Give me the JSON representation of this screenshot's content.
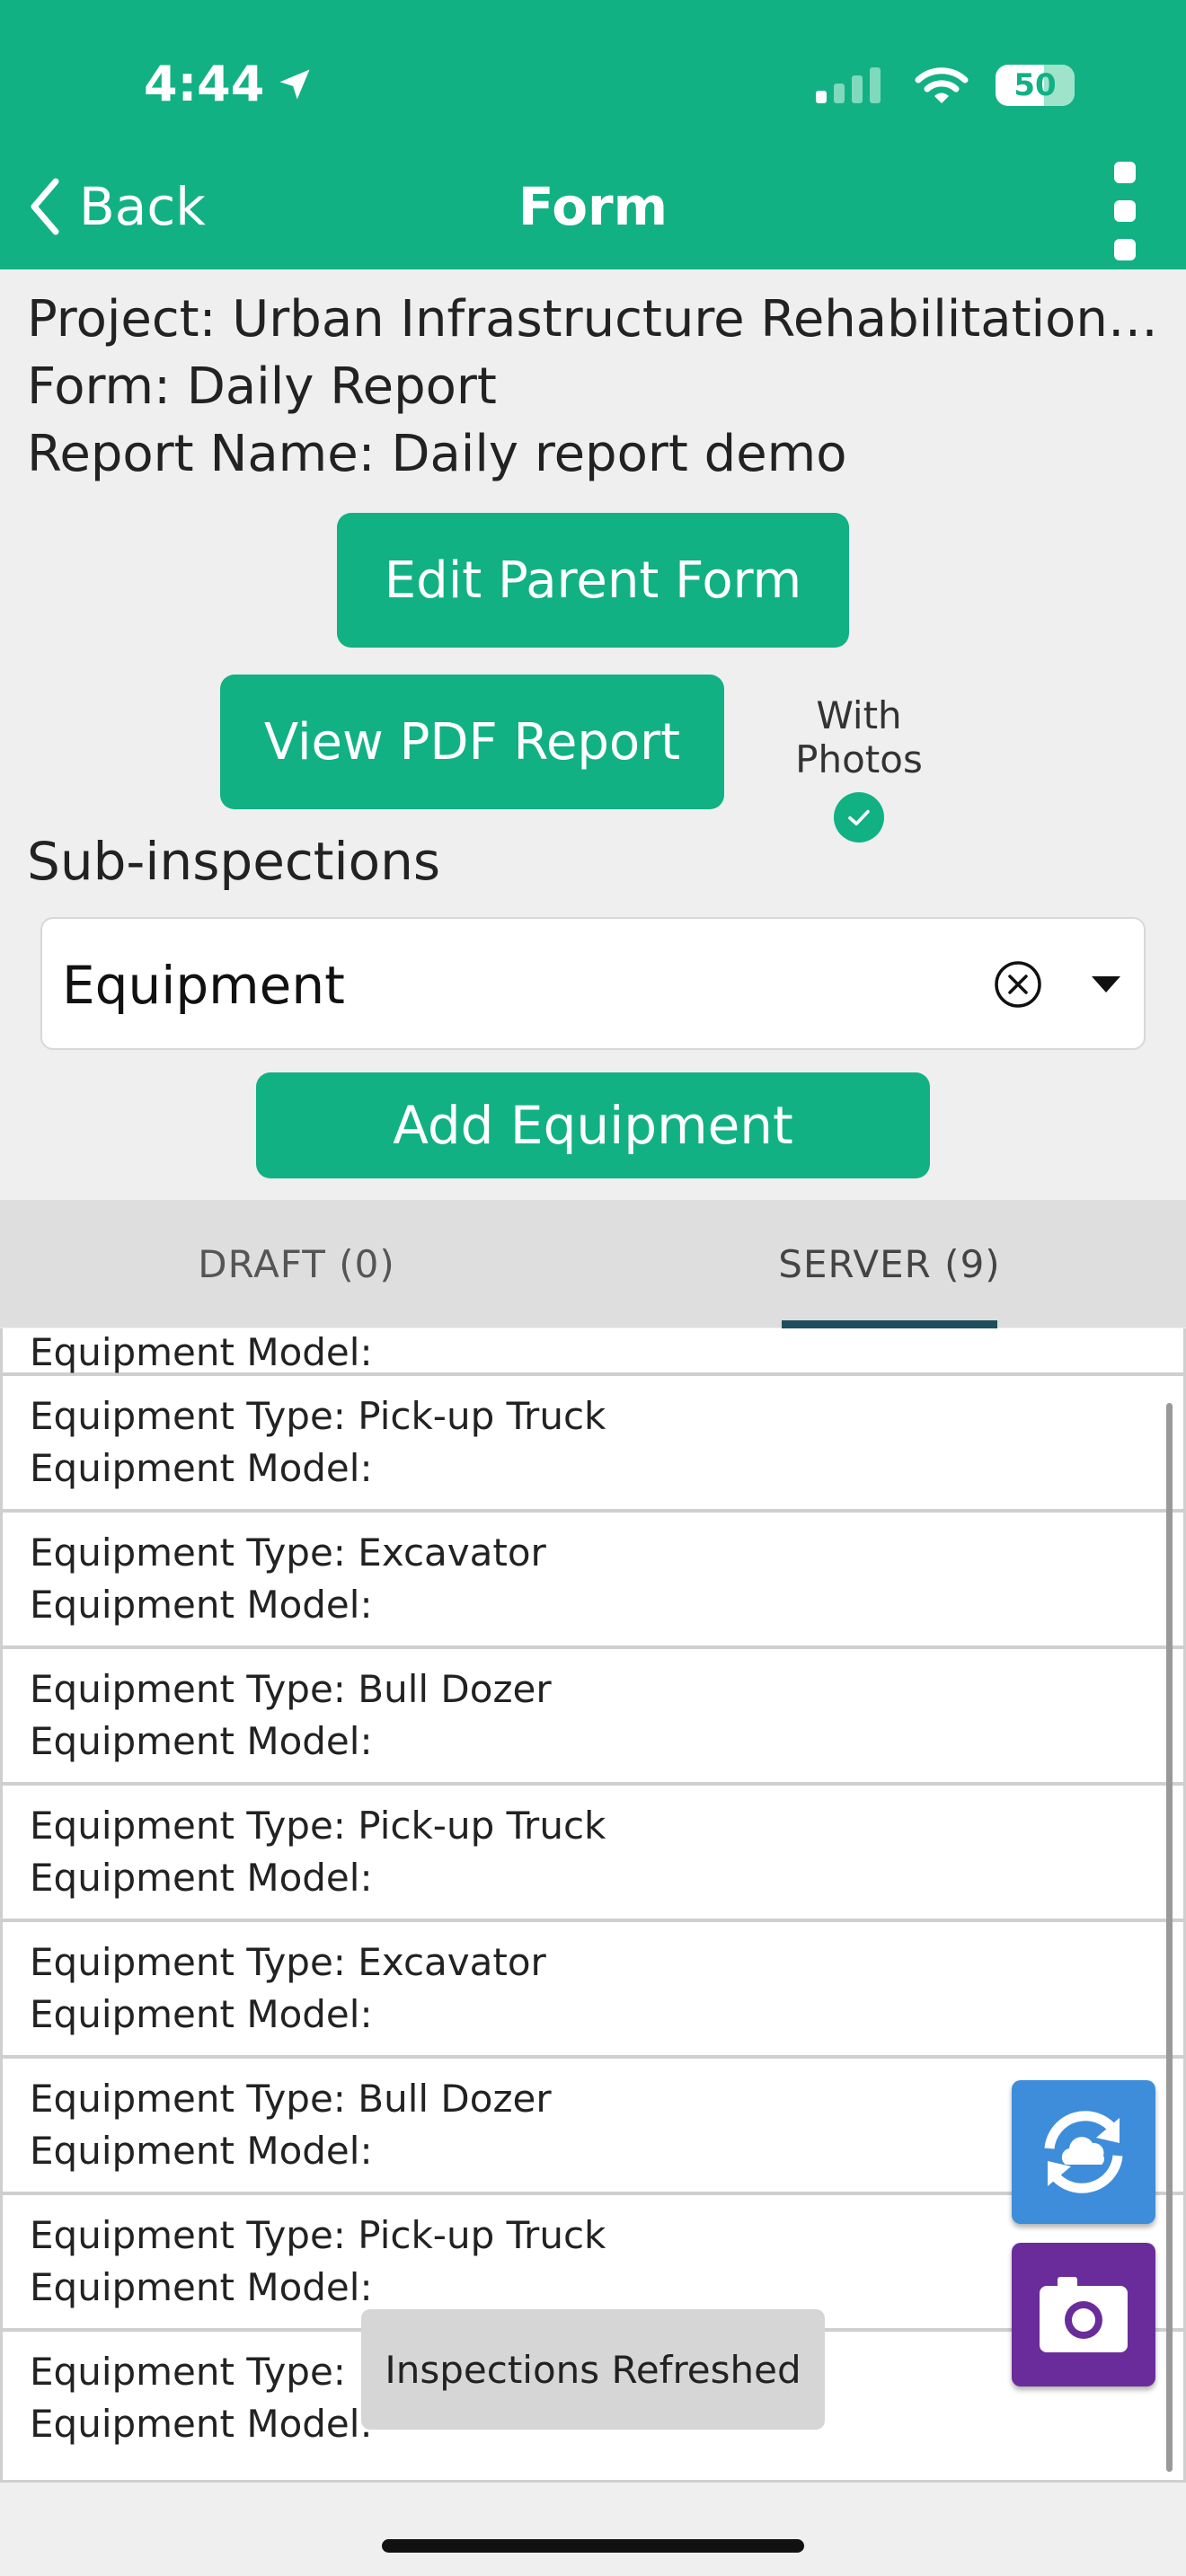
{
  "status_bar": {
    "time": "4:44",
    "battery": "50"
  },
  "nav": {
    "back_label": "Back",
    "title": "Form"
  },
  "info": {
    "project": "Project: Urban Infrastructure Rehabilitation Pr…",
    "form": "Form: Daily Report",
    "report_name": "Report Name: Daily report demo"
  },
  "actions": {
    "edit_parent_form": "Edit Parent Form",
    "view_pdf_report": "View PDF Report",
    "with_photos_label": "With Photos",
    "with_photos_checked": true
  },
  "sub_inspections": {
    "label": "Sub-inspections",
    "selected": "Equipment",
    "add_button": "Add Equipment"
  },
  "tabs": [
    {
      "label": "DRAFT (0)",
      "active": false
    },
    {
      "label": "SERVER (9)",
      "active": true
    }
  ],
  "list": {
    "rows": [
      {
        "line1": "",
        "line2": "Equipment Model:"
      },
      {
        "line1": "Equipment Type: Pick-up Truck",
        "line2": "Equipment Model:"
      },
      {
        "line1": "Equipment Type: Excavator",
        "line2": "Equipment Model:"
      },
      {
        "line1": "Equipment Type: Bull Dozer",
        "line2": "Equipment Model:"
      },
      {
        "line1": "Equipment Type: Pick-up Truck",
        "line2": "Equipment Model:"
      },
      {
        "line1": "Equipment Type: Excavator",
        "line2": "Equipment Model:"
      },
      {
        "line1": "Equipment Type: Bull Dozer",
        "line2": "Equipment Model:"
      },
      {
        "line1": "Equipment Type: Pick-up Truck",
        "line2": "Equipment Model:"
      },
      {
        "line1": "Equipment Type: Ex",
        "line2": "Equipment Model:"
      }
    ]
  },
  "toast": {
    "message": "Inspections Refreshed"
  },
  "colors": {
    "primary": "#11b184",
    "tab_indicator": "#1f4f5c",
    "sync_fab": "#3d8ddb",
    "camera_fab": "#6a2c9a"
  }
}
